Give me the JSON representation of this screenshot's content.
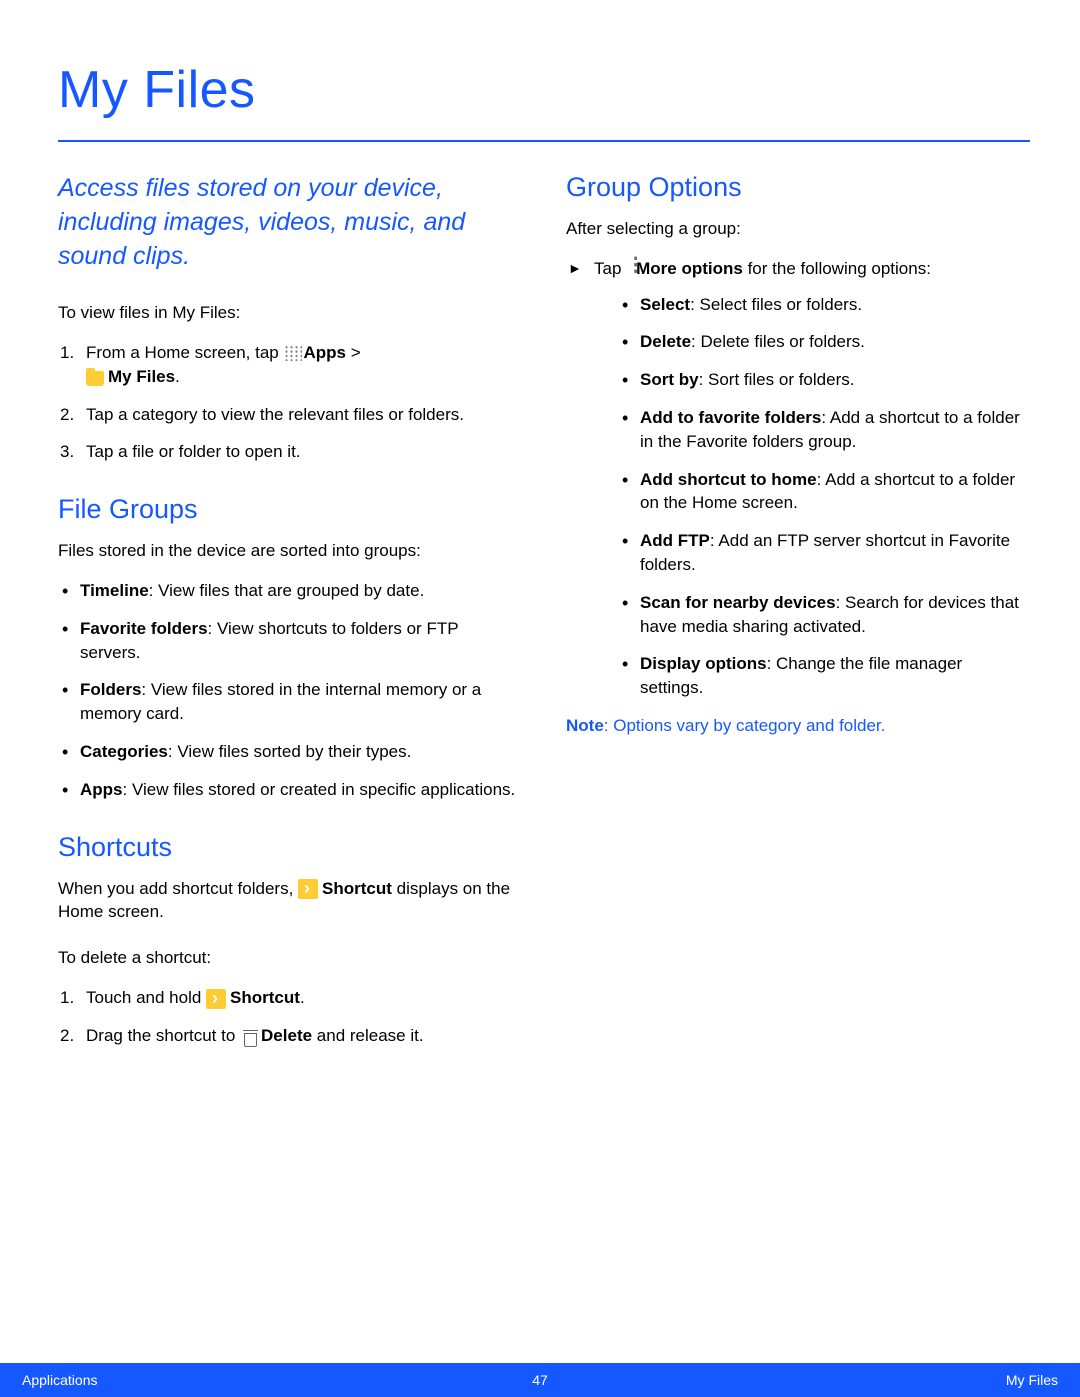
{
  "title": "My Files",
  "intro": "Access files stored on your device, including images, videos, music, and sound clips.",
  "view_lead": "To view files in My Files:",
  "view_steps": {
    "s1_prefix": "From a Home screen, tap ",
    "s1_apps": "Apps",
    "s1_gt": " > ",
    "s1_myfiles": "My Files",
    "s1_period": ".",
    "s2": "Tap a category to view the relevant files or folders.",
    "s3": "Tap a file or folder to open it."
  },
  "file_groups": {
    "heading": "File Groups",
    "lead": "Files stored in the device are sorted into groups:",
    "items": [
      {
        "label": "Timeline",
        "text": ": View files that are grouped by date."
      },
      {
        "label": "Favorite folders",
        "text": ": View shortcuts to folders or FTP servers."
      },
      {
        "label": "Folders",
        "text": ": View files stored in the internal memory or a memory card."
      },
      {
        "label": "Categories",
        "text": ": View files sorted by their types."
      },
      {
        "label": "Apps",
        "text": ": View files stored or created in specific applications."
      }
    ]
  },
  "shortcuts": {
    "heading": "Shortcuts",
    "lead_prefix": "When you add shortcut folders, ",
    "lead_label": "Shortcut",
    "lead_suffix": " displays on the Home screen.",
    "delete_lead": "To delete a shortcut:",
    "s1_prefix": "Touch and hold ",
    "s1_label": "Shortcut",
    "s1_suffix": ".",
    "s2_prefix": "Drag the shortcut to ",
    "s2_label": "Delete",
    "s2_suffix": " and release it."
  },
  "group_options": {
    "heading": "Group Options",
    "lead": "After selecting a group:",
    "arrow_prefix": "Tap ",
    "arrow_label": "More options",
    "arrow_suffix": " for the following options:",
    "items": [
      {
        "label": "Select",
        "text": ": Select files or folders."
      },
      {
        "label": "Delete",
        "text": ": Delete files or folders."
      },
      {
        "label": "Sort by",
        "text": ": Sort files or folders."
      },
      {
        "label": "Add to favorite folders",
        "text": ": Add a shortcut to a folder in the Favorite folders group."
      },
      {
        "label": "Add shortcut to home",
        "text": ": Add a shortcut to a folder on the Home screen."
      },
      {
        "label": "Add FTP",
        "text": ": Add an FTP server shortcut in Favorite folders."
      },
      {
        "label": "Scan for nearby devices",
        "text": ": Search for devices that have media sharing activated."
      },
      {
        "label": "Display options",
        "text": ": Change the file manager settings."
      }
    ],
    "note_label": "Note",
    "note_text": ": Options vary by category and folder."
  },
  "footer": {
    "left": "Applications",
    "center": "47",
    "right": "My Files"
  }
}
